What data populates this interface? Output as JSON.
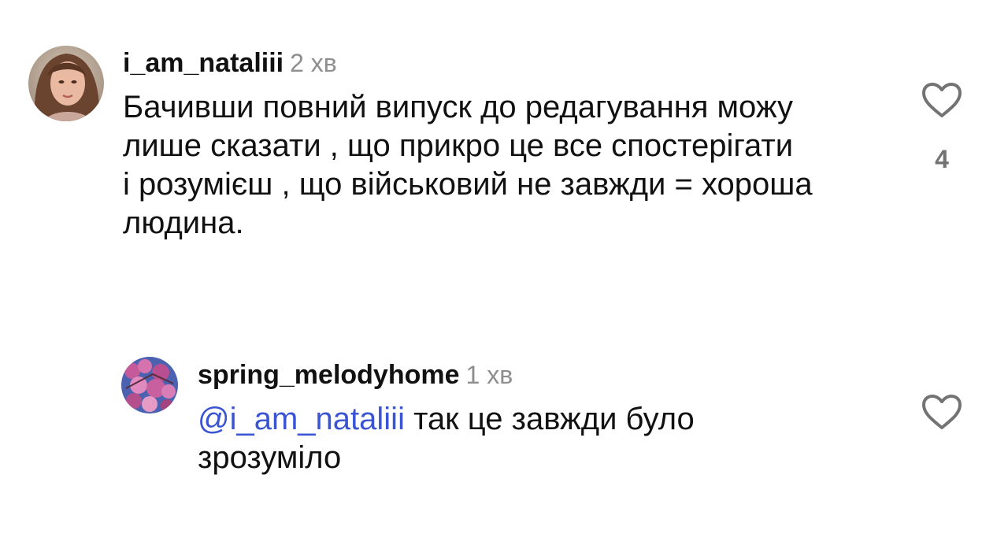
{
  "comments": [
    {
      "username": "i_am_nataliii",
      "time": "2 хв",
      "lines": [
        "Бачивши повний випуск до редагування можу",
        "лише сказати , що прикро це все спостерігати",
        "і розумієш , що військовий не завжди = хороша",
        "людина."
      ],
      "likes": "4",
      "icon": "heart-outline-icon"
    },
    {
      "username": "spring_melodyhome",
      "time": "1 хв",
      "mention": "@i_am_nataliii",
      "lines": [
        " так це завжди було",
        "зрозуміло"
      ],
      "icon": "heart-outline-icon"
    }
  ],
  "colors": {
    "mention": "#3b54d2",
    "secondary_text": "#8e8e8e",
    "like_count": "#737373",
    "icon": "#737373"
  }
}
